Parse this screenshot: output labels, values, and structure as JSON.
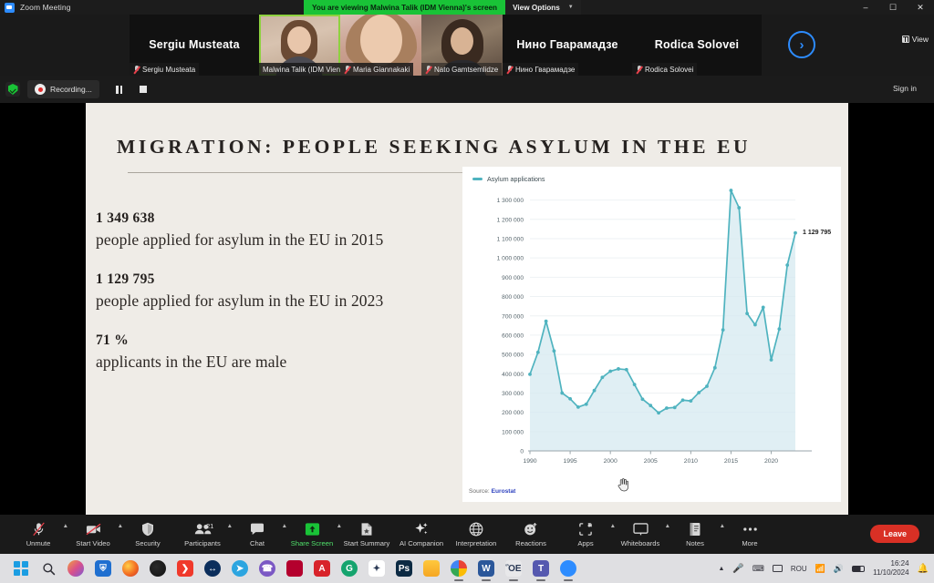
{
  "window": {
    "app_title": "Zoom Meeting",
    "share_banner": "You are viewing Malwina Talik (IDM Vienna)'s screen",
    "view_options_label": "View Options",
    "minimize_icon": "minimize-icon",
    "maximize_icon": "maximize-icon",
    "close_icon": "close-icon"
  },
  "filmstrip": {
    "view_button_label": "View",
    "next_arrow_icon": "chevron-right-icon",
    "participants": [
      {
        "display_name": "Sergiu Musteata",
        "name_tag": "Sergiu Musteata",
        "video_on": false,
        "muted": true,
        "active_speaker": false
      },
      {
        "display_name": "Malwina Talik (IDM Vienna)",
        "name_tag": "Malwina Talik (IDM Vienna)",
        "video_on": true,
        "muted": false,
        "active_speaker": true
      },
      {
        "display_name": "Maria Giannakaki",
        "name_tag": "Maria Giannakaki",
        "video_on": true,
        "muted": true,
        "active_speaker": false
      },
      {
        "display_name": "Nato Gamtsemlidze",
        "name_tag": "Nato Gamtsemlidze",
        "video_on": true,
        "muted": true,
        "active_speaker": false
      },
      {
        "display_name": "Нино Гварамадзе",
        "name_tag": "Нино Гварамадзе",
        "video_on": false,
        "muted": true,
        "active_speaker": false
      },
      {
        "display_name": "Rodica Solovei",
        "name_tag": "Rodica Solovei",
        "video_on": false,
        "muted": true,
        "active_speaker": false
      }
    ]
  },
  "recording_bar": {
    "shield_icon": "security-shield-icon",
    "recording_icon": "recording-dot-icon",
    "recording_label": "Recording...",
    "pause_icon": "pause-icon",
    "stop_icon": "stop-icon",
    "sign_in_label": "Sign in"
  },
  "slide": {
    "title": "MIGRATION: PEOPLE SEEKING ASYLUM IN THE EU",
    "background_color": "#efece7",
    "facts": [
      {
        "number": "1 349 638",
        "text": "people applied for asylum in the EU in 2015"
      },
      {
        "number": "1 129 795",
        "text": "people applied for asylum in the EU in 2023"
      },
      {
        "number": "71 %",
        "text": "applicants in the EU are male"
      }
    ],
    "source_prefix": "Source:",
    "source_name": "Eurostat"
  },
  "chart_data": {
    "type": "area",
    "title": "",
    "legend": [
      "Asylum applications"
    ],
    "legend_position": "top-left",
    "series_color": "#4fb3bf",
    "fill_color": "#d6eaf0",
    "xlabel": "",
    "ylabel": "",
    "grid": true,
    "xlim": [
      1990,
      2023
    ],
    "ylim": [
      0,
      1350000
    ],
    "ytick_labels": [
      "0",
      "100 000",
      "200 000",
      "300 000",
      "400 000",
      "500 000",
      "600 000",
      "700 000",
      "800 000",
      "900 000",
      "1 000 000",
      "1 100 000",
      "1 200 000",
      "1 300 000"
    ],
    "yticks": [
      0,
      100000,
      200000,
      300000,
      400000,
      500000,
      600000,
      700000,
      800000,
      900000,
      1000000,
      1100000,
      1200000,
      1300000
    ],
    "xtick_labels": [
      "1990",
      "1995",
      "2000",
      "2005",
      "2010",
      "2015",
      "2020"
    ],
    "xticks": [
      1990,
      1995,
      2000,
      2005,
      2010,
      2015,
      2020
    ],
    "annotations": [
      {
        "x": 2023,
        "y": 1129795,
        "label": "1 129 795"
      }
    ],
    "x": [
      1990,
      1991,
      1992,
      1993,
      1994,
      1995,
      1996,
      1997,
      1998,
      1999,
      2000,
      2001,
      2002,
      2003,
      2004,
      2005,
      2006,
      2007,
      2008,
      2009,
      2010,
      2011,
      2012,
      2013,
      2014,
      2015,
      2016,
      2017,
      2018,
      2019,
      2020,
      2021,
      2022,
      2023
    ],
    "series": [
      {
        "name": "Asylum applications",
        "values": [
          397000,
          511000,
          672000,
          518000,
          300000,
          270000,
          227000,
          242000,
          313000,
          381000,
          413000,
          425000,
          421000,
          344000,
          268000,
          235000,
          197000,
          222000,
          225000,
          263000,
          259000,
          302000,
          335000,
          431000,
          627000,
          1349638,
          1260000,
          712000,
          654000,
          744000,
          472000,
          632000,
          963000,
          1129795
        ]
      }
    ]
  },
  "zoom_toolbar": {
    "items": [
      {
        "label": "Unmute",
        "icon": "mic-muted-icon",
        "caret": true,
        "green": false
      },
      {
        "label": "Start Video",
        "icon": "video-off-icon",
        "caret": true,
        "green": false
      },
      {
        "label": "Security",
        "icon": "shield-icon",
        "caret": false,
        "green": false
      },
      {
        "label": "Participants",
        "icon": "participants-icon",
        "caret": true,
        "green": false,
        "badge": "21"
      },
      {
        "label": "Chat",
        "icon": "chat-bubble-icon",
        "caret": true,
        "green": false
      },
      {
        "label": "Share Screen",
        "icon": "share-screen-icon",
        "caret": true,
        "green": true
      },
      {
        "label": "Start Summary",
        "icon": "summary-doc-icon",
        "caret": false,
        "green": false
      },
      {
        "label": "AI Companion",
        "icon": "ai-sparkle-icon",
        "caret": false,
        "green": false
      },
      {
        "label": "Interpretation",
        "icon": "globe-icon",
        "caret": false,
        "green": false
      },
      {
        "label": "Reactions",
        "icon": "emoji-reaction-icon",
        "caret": false,
        "green": false
      },
      {
        "label": "Apps",
        "icon": "apps-icon",
        "caret": true,
        "green": false
      },
      {
        "label": "Whiteboards",
        "icon": "whiteboard-icon",
        "caret": true,
        "green": false
      },
      {
        "label": "Notes",
        "icon": "notes-icon",
        "caret": true,
        "green": false
      },
      {
        "label": "More",
        "icon": "ellipsis-icon",
        "caret": false,
        "green": false
      }
    ],
    "leave_label": "Leave",
    "annotate_icon": "pen-icon"
  },
  "taskbar": {
    "icons": [
      "windows-start-icon",
      "search-icon",
      "copilot-icon",
      "windows-security-icon",
      "firefox-icon",
      "opera-gx-icon",
      "ab-download-icon",
      "teamviewer-icon",
      "telegram-icon",
      "viber-icon",
      "opera-icon",
      "adobe-acrobat-icon",
      "grammarly-icon",
      "pdf-tool-icon",
      "photoshop-icon",
      "file-explorer-icon",
      "chrome-icon",
      "word-icon",
      "save-icon",
      "teams-icon",
      "zoom-icon"
    ],
    "tray": {
      "chevron_icon": "show-hidden-icons-icon",
      "mic_icon": "microphone-icon",
      "keyboard_icon": "keyboard-icon",
      "touchpad_icon": "touchpad-icon",
      "language": "ROU",
      "wifi_icon": "wifi-icon",
      "volume_icon": "volume-icon",
      "battery_icon": "battery-icon",
      "time": "16:24",
      "date": "11/10/2024",
      "notification_icon": "bell-icon"
    }
  }
}
